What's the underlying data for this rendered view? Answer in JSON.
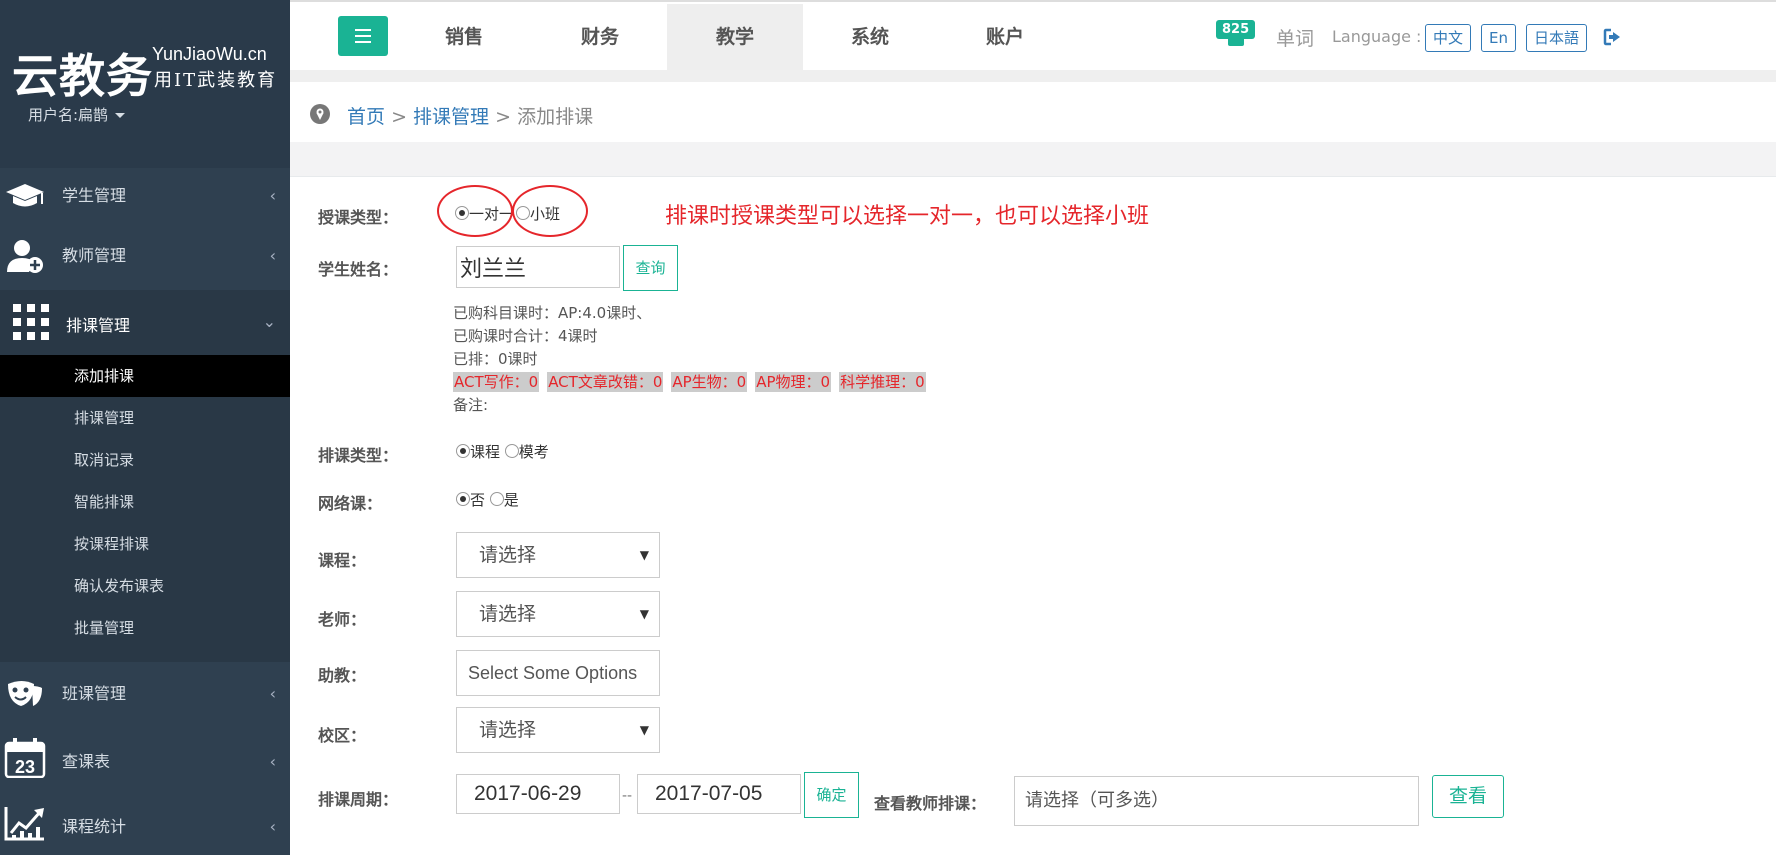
{
  "sidebar": {
    "logo_main": "云教务",
    "logo_url": "YunJiaoWu.cn",
    "logo_slogan": "用IT武装教育",
    "user_label": "用户名:扁鹊",
    "nav": [
      {
        "label": "学生管理",
        "icon": "graduation-cap-icon"
      },
      {
        "label": "教师管理",
        "icon": "user-add-icon"
      },
      {
        "label": "排课管理",
        "icon": "grid-icon"
      },
      {
        "label": "班课管理",
        "icon": "theater-masks-icon"
      },
      {
        "label": "查课表",
        "icon": "calendar-icon",
        "day": "23"
      },
      {
        "label": "课程统计",
        "icon": "line-chart-icon"
      }
    ],
    "submenu": [
      "添加排课",
      "排课管理",
      "取消记录",
      "智能排课",
      "按课程排课",
      "确认发布课表",
      "批量管理"
    ]
  },
  "topbar": {
    "tabs": [
      "销售",
      "财务",
      "教学",
      "系统",
      "账户"
    ],
    "active_tab": "教学",
    "badge": "825",
    "vocab": "单词",
    "language_label": "Language :",
    "languages": [
      "中文",
      "En",
      "日本語"
    ]
  },
  "breadcrumb": {
    "home": "首页",
    "parent": "排课管理",
    "current": "添加排课",
    "sep": ">"
  },
  "form": {
    "teach_type_label": "授课类型：",
    "teach_type_options": [
      "一对一",
      "小班"
    ],
    "annotation": "排课时授课类型可以选择一对一，也可以选择小班",
    "student_label": "学生姓名：",
    "student_value": "刘兰兰",
    "query_button": "查询",
    "info_lines": [
      "已购科目课时：AP:4.0课时、",
      "已购课时合计：4课时",
      "已排：0课时"
    ],
    "tags": [
      "ACT写作：0",
      "ACT文章改错：0",
      "AP生物：0",
      "AP物理：0",
      "科学推理：0"
    ],
    "remark": "备注:",
    "schedule_type_label": "排课类型：",
    "schedule_type_options": [
      "课程",
      "模考"
    ],
    "online_label": "网络课：",
    "online_options": [
      "否",
      "是"
    ],
    "course_label": "课程：",
    "course_value": "请选择",
    "teacher_label": "老师：",
    "teacher_value": "请选择",
    "assistant_label": "助教：",
    "assistant_placeholder": "Select Some Options",
    "campus_label": "校区：",
    "campus_value": "请选择",
    "period_label": "排课周期：",
    "date_start": "2017-06-29",
    "date_sep": "--",
    "date_end": "2017-07-05",
    "confirm_button": "确定",
    "view_teacher_label": "查看教师排课：",
    "view_teacher_placeholder": "请选择（可多选）",
    "view_button": "查看"
  },
  "colors": {
    "sidebar_bg": "#2f4050",
    "accent": "#1ab394",
    "link": "#337ab7",
    "annotation": "#e5262b"
  }
}
